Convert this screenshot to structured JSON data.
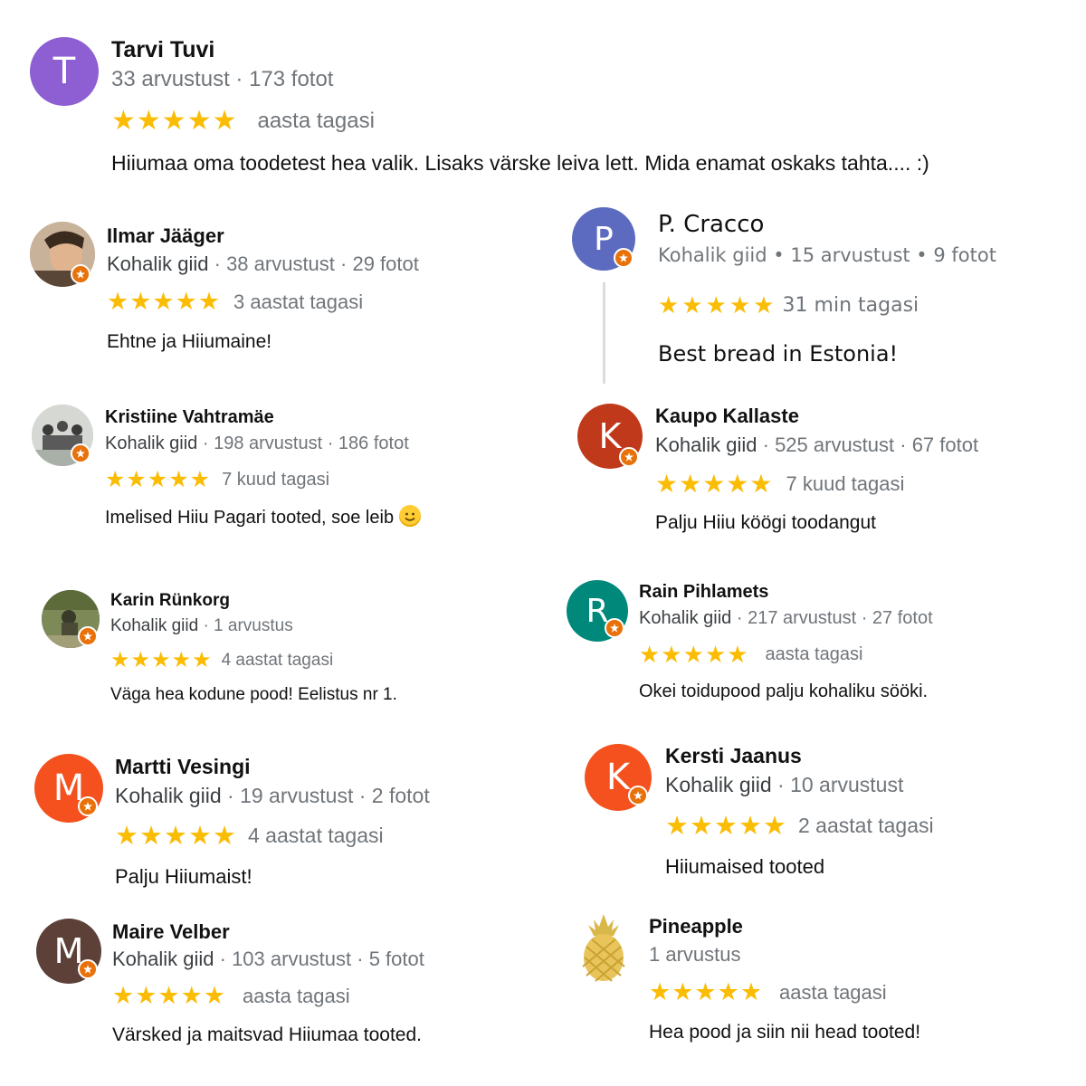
{
  "reviews": [
    {
      "name": "Tarvi Tuvi",
      "avatar_letter": "T",
      "avatar_color": "#8e5fd3",
      "guide": "",
      "meta": "33 arvustust · 173 fotot",
      "stars": "★★★★★",
      "time": "aasta tagasi",
      "text": "Hiiumaa oma toodetest hea valik. Lisaks värske leiva lett. Mida enamat oskaks tahta.... :)"
    },
    {
      "name": "Ilmar Jääger",
      "avatar_letter": "",
      "avatar_color": "#8a6a50",
      "guide": "Kohalik giid",
      "meta": " · 38 arvustust · 29 fotot",
      "stars": "★★★★★",
      "time": "3 aastat tagasi",
      "text": "Ehtne ja Hiiumaine!"
    },
    {
      "name": "P. Cracco",
      "avatar_letter": "P",
      "avatar_color": "#5c6bc0",
      "guide": "Kohalik giid",
      "meta": " • 15 arvustust • 9 fotot",
      "stars": "★★★★★",
      "time": "31 min tagasi",
      "text": "Best bread in Estonia!"
    },
    {
      "name": "Kristiine Vahtramäe",
      "avatar_letter": "",
      "avatar_color": "#9aa59a",
      "guide": "Kohalik giid",
      "meta": " · 198 arvustust · 186 fotot",
      "stars": "★★★★★",
      "time": "7 kuud tagasi",
      "text": "Imelised Hiiu Pagari tooted, soe leib"
    },
    {
      "name": "Kaupo Kallaste",
      "avatar_letter": "K",
      "avatar_color": "#c0391b",
      "guide": "Kohalik giid",
      "meta": " · 525 arvustust · 67 fotot",
      "stars": "★★★★★",
      "time": "7 kuud tagasi",
      "text": "Palju Hiiu köögi toodangut"
    },
    {
      "name": "Karin Rünkorg",
      "avatar_letter": "",
      "avatar_color": "#6b7a4a",
      "guide": "Kohalik giid",
      "meta": " · 1 arvustus",
      "stars": "★★★★★",
      "time": "4 aastat tagasi",
      "text": "Väga hea kodune pood! Eelistus nr 1."
    },
    {
      "name": "Rain Pihlamets",
      "avatar_letter": "R",
      "avatar_color": "#00897b",
      "guide": "Kohalik giid",
      "meta": " · 217 arvustust · 27 fotot",
      "stars": "★★★★★",
      "time": "aasta tagasi",
      "text": "Okei toidupood palju kohaliku sööki."
    },
    {
      "name": "Martti Vesingi",
      "avatar_letter": "M",
      "avatar_color": "#f4511e",
      "guide": "Kohalik giid",
      "meta": " · 19 arvustust · 2 fotot",
      "stars": "★★★★★",
      "time": "4 aastat tagasi",
      "text": "Palju Hiiumaist!"
    },
    {
      "name": "Kersti Jaanus",
      "avatar_letter": "K",
      "avatar_color": "#f4511e",
      "guide": "Kohalik giid",
      "meta": " · 10 arvustust",
      "stars": "★★★★★",
      "time": "2 aastat tagasi",
      "text": "Hiiumaised tooted"
    },
    {
      "name": "Maire Velber",
      "avatar_letter": "M",
      "avatar_color": "#5d4037",
      "guide": "Kohalik giid",
      "meta": " · 103 arvustust · 5 fotot",
      "stars": "★★★★★",
      "time": "aasta tagasi",
      "text": "Värsked ja maitsvad Hiiumaa tooted."
    },
    {
      "name": "Pineapple",
      "avatar_letter": "",
      "avatar_color": "#e8c45a",
      "guide": "",
      "meta": "1 arvustus",
      "stars": "★★★★★",
      "time": "aasta tagasi",
      "text": "Hea pood ja siin nii head tooted!"
    }
  ],
  "colors": {
    "star": "#fbbc04",
    "badge": "#e8710a",
    "meta": "#70757a"
  },
  "icons": {
    "badge": "local-guide-star-icon",
    "emoji": "smiling-face-icon"
  }
}
